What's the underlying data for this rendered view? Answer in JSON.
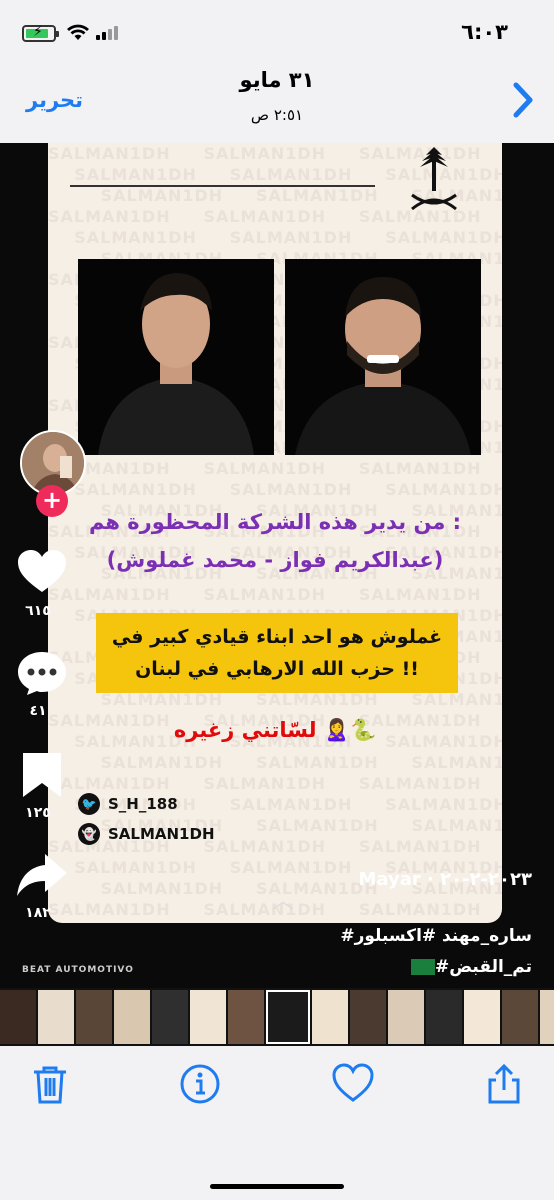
{
  "status_bar": {
    "time": "٦:٠٣"
  },
  "header": {
    "title": "٣١ مايو",
    "subtitle": "٢:٥١ ص",
    "edit_label": "تحرير",
    "back_icon": "chevron-right-icon"
  },
  "post_image": {
    "watermark": "SALMAN1DH",
    "question_line": "من يدير هذه الشركة المحظورة هم :",
    "names_line": "(عبدالكريم فواز - محمد غملوش)",
    "highlight_line1": "غملوش هو احد ابناء قيادي كبير في",
    "highlight_line2": "حزب الله الارهابي في لبنان !!",
    "red_line": "لسّاتني زغيره 🙎‍♀️🐍",
    "twitter_handle": "S_H_188",
    "snapchat_handle": "SALMAN1DH"
  },
  "tiktok": {
    "likes": "٦١٥",
    "comments": "٤١",
    "saves": "١٢٥",
    "shares": "١٨٢",
    "author_line": "Mayar · ٢٠٢٣-٢-٢٠",
    "hashtag_line1": "#ساره_مهند #اكسبلور",
    "hashtag_line2": "#تم_القبض",
    "music_tag": "BEAT AUTOMOTIVO"
  },
  "toolbar": {
    "delete_icon": "trash-icon",
    "info_icon": "info-icon",
    "favorite_icon": "heart-icon",
    "share_icon": "share-icon"
  },
  "colors": {
    "accent": "#1e7cf0",
    "purple_text": "#7b2fb5",
    "highlight": "#f5c40c",
    "red_text": "#e10a0a",
    "plus_button": "#ee2b5a"
  }
}
